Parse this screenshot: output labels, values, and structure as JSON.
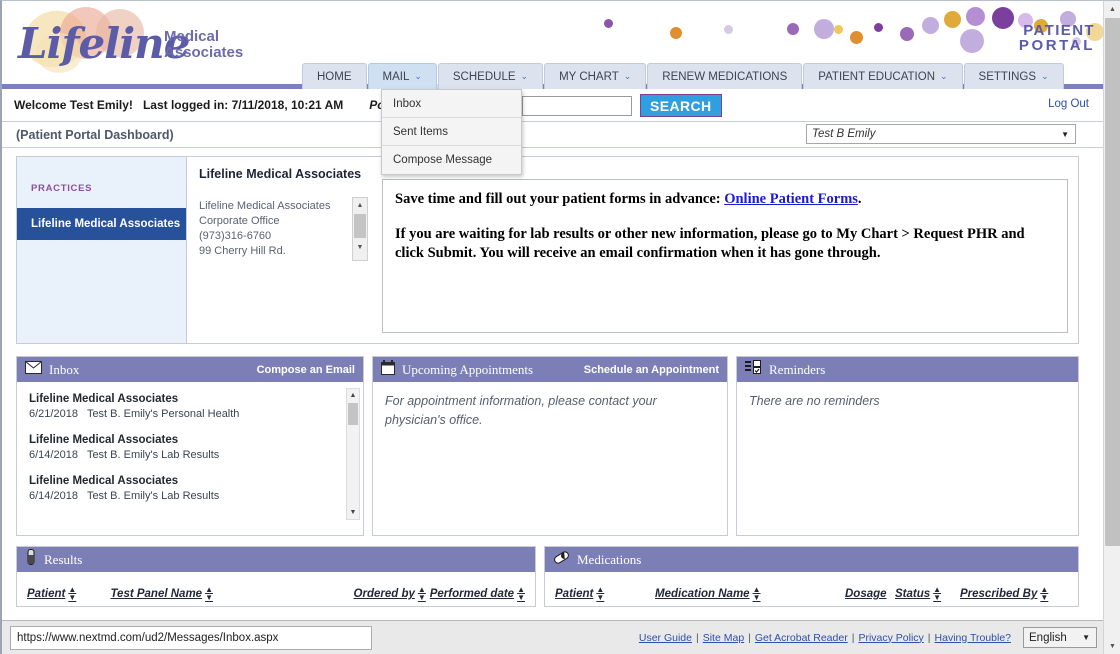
{
  "brand": {
    "logo_word": "Lifeline",
    "logo_sub_line1": "Medical",
    "logo_sub_line2": "Associates",
    "portal_line1": "PATIENT",
    "portal_line2": "PORTAL",
    "accent_purple": "#5b5ba8",
    "panel_header": "#7b7fb5",
    "practice_active": "#27529b"
  },
  "nav": {
    "tabs": [
      {
        "label": "HOME",
        "caret": "",
        "active": false
      },
      {
        "label": "MAIL",
        "caret": "⌄",
        "active": true
      },
      {
        "label": "SCHEDULE",
        "caret": "⌄",
        "active": false
      },
      {
        "label": "MY CHART",
        "caret": "⌄",
        "active": false
      },
      {
        "label": "RENEW MEDICATIONS",
        "caret": "",
        "active": false
      },
      {
        "label": "PATIENT EDUCATION",
        "caret": "⌄",
        "active": false
      },
      {
        "label": "SETTINGS",
        "caret": "⌄",
        "active": false
      }
    ]
  },
  "dropdown": {
    "items": [
      {
        "label": "Inbox"
      },
      {
        "label": "Sent Items"
      },
      {
        "label": "Compose Message"
      }
    ]
  },
  "welcome": {
    "greeting": "Welcome Test Emily!",
    "last_logged": "Last logged in: 7/11/2018, 10:21 AM",
    "search_label": "Portal Search:",
    "search_value": "",
    "search_placeholder": "",
    "search_button": "SEARCH",
    "logout": "Log Out"
  },
  "breadcrumb": {
    "text": "(Patient Portal Dashboard)",
    "patient_selected": "Test B Emily",
    "caret": "▼"
  },
  "practices": {
    "label": "PRACTICES",
    "items": [
      {
        "name": "Lifeline Medical Associates",
        "selected": true
      }
    ],
    "detail_title": "Lifeline Medical Associates",
    "detail_lines": [
      "Lifeline Medical Associates",
      "Corporate Office",
      "(973)316-6760",
      "99 Cherry Hill Rd."
    ]
  },
  "announcement": {
    "line1_pre": "Save time and fill out your patient forms in advance: ",
    "line1_link": "Online Patient Forms",
    "line1_post": ".",
    "line2": "If you are waiting for lab results or other new information, please go to My Chart > Request PHR and click Submit. You will receive an email confirmation when it has gone through."
  },
  "widgets": {
    "inbox": {
      "title": "Inbox",
      "icon": "envelope-icon",
      "action": "Compose an Email",
      "messages": [
        {
          "from": "Lifeline Medical Associates",
          "date": "6/21/2018",
          "subject": "Test B. Emily's Personal Health"
        },
        {
          "from": "Lifeline Medical Associates",
          "date": "6/14/2018",
          "subject": "Test B. Emily's Lab Results"
        },
        {
          "from": "Lifeline Medical Associates",
          "date": "6/14/2018",
          "subject": "Test B. Emily's Lab Results"
        }
      ]
    },
    "appointments": {
      "title": "Upcoming Appointments",
      "icon": "calendar-icon",
      "action": "Schedule an Appointment",
      "empty_text": "For appointment information, please contact your physician's office."
    },
    "reminders": {
      "title": "Reminders",
      "icon": "checklist-icon",
      "action": "",
      "empty_text": "There are no reminders"
    }
  },
  "tables": {
    "results": {
      "title": "Results",
      "icon": "test-tube-icon",
      "columns": [
        "Patient",
        "Test Panel Name",
        "Ordered by",
        "Performed date"
      ]
    },
    "medications": {
      "title": "Medications",
      "icon": "pill-icon",
      "columns": [
        "Patient",
        "Medication Name",
        "Dosage",
        "Status",
        "Prescribed By"
      ],
      "sortable": [
        true,
        true,
        false,
        true,
        true
      ]
    }
  },
  "statusbar": {
    "url": "https://www.nextmd.com/ud2/Messages/Inbox.aspx",
    "links": [
      "User Guide",
      "Site Map",
      "Get Acrobat Reader",
      "Privacy Policy",
      "Having Trouble?"
    ],
    "separator": "|",
    "language": "English",
    "lang_caret": "▼"
  },
  "scroll": {
    "up": "▲",
    "down": "▼"
  }
}
